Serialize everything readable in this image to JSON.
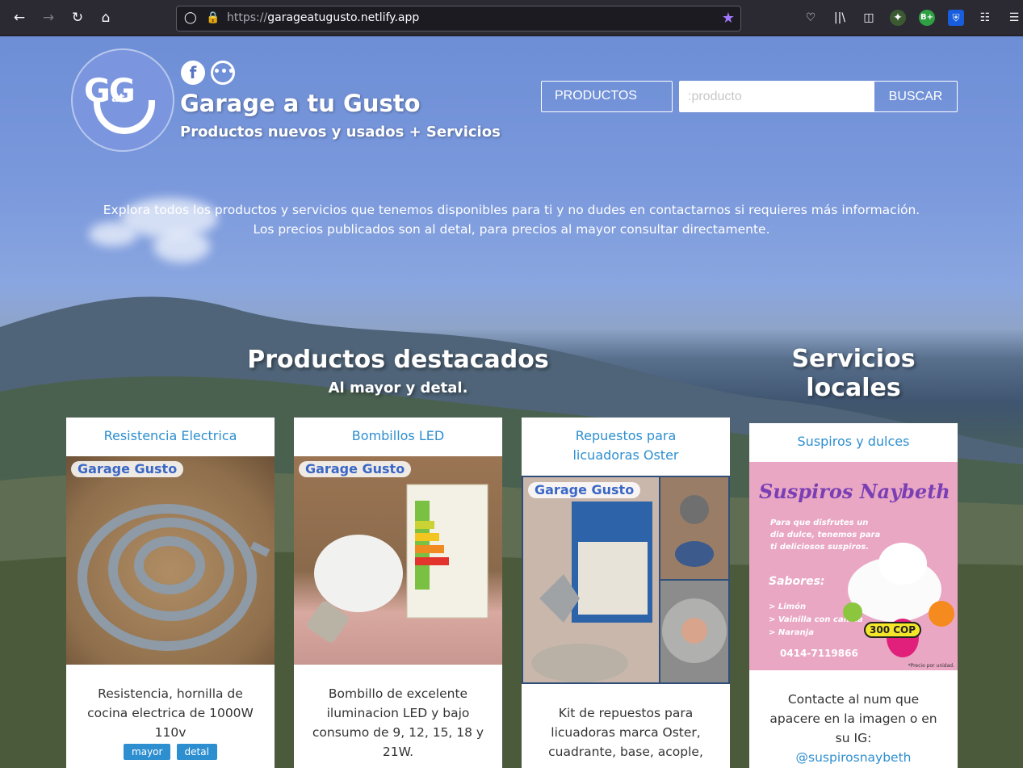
{
  "browser": {
    "url_scheme": "https://",
    "url_host": "garageatugusto.netlify.app",
    "nav_icons": [
      "back-arrow-icon",
      "forward-arrow-icon",
      "reload-icon",
      "home-icon"
    ],
    "toolbar_icons": [
      "pocket-icon",
      "library-icon",
      "sidebar-icon",
      "extension-shield-icon",
      "extension-badge-icon",
      "bitwarden-icon",
      "extension-grid-icon",
      "menu-icon"
    ],
    "ext_badge_label": "B+"
  },
  "header": {
    "logo_letters": "GG",
    "logo_at": "at",
    "title": "Garage a tu Gusto",
    "subtitle": "Productos nuevos y usados + Servicios",
    "social_icons": [
      "facebook-icon",
      "chat-icon"
    ]
  },
  "search": {
    "category_value": "PRODUCTOS",
    "placeholder": ":producto",
    "button_label": "BUSCAR"
  },
  "intro": {
    "line1": "Explora todos los productos y servicios que tenemos disponibles para ti y no dudes en contactarnos si requieres más información.",
    "line2": "Los precios publicados son al detal, para precios al mayor consultar directamente."
  },
  "featured": {
    "heading": "Productos destacados",
    "subheading": "Al mayor y detal."
  },
  "services": {
    "heading_line1": "Servicios",
    "heading_line2": "locales"
  },
  "cards": [
    {
      "title": "Resistencia Electrica",
      "image_watermark": "Garage Gusto",
      "description": "Resistencia, hornilla de cocina electrica de 1000W 110v",
      "tags": [
        "mayor",
        "detal"
      ]
    },
    {
      "title": "Bombillos LED",
      "image_watermark": "Garage Gusto",
      "description": "Bombillo de excelente iluminacion LED y bajo consumo de 9, 12, 15, 18 y 21W.",
      "tags": []
    },
    {
      "title_line1": "Repuestos para",
      "title_line2": "licuadoras Oster",
      "image_watermark": "Garage Gusto",
      "description": "Kit de repuestos para licuadoras marca Oster, cuadrante, base, acople,",
      "tags": []
    },
    {
      "title": "Suspiros y dulces",
      "flyer": {
        "brand": "Suspiros Naybeth",
        "tagline": "Para que disfrutes un dia dulce, tenemos para ti deliciosos suspiros.",
        "flavors_label": "Sabores:",
        "flavors": [
          "> Limón",
          "> Vainilla con canela",
          "> Naranja"
        ],
        "price": "300 COP",
        "phone": "0414-7119866",
        "note": "*Precio por unidad."
      },
      "description": "Contacte al num que apacere en la imagen o en su IG:",
      "instagram": "@suspirosnaybeth"
    }
  ],
  "colors": {
    "accent": "#2e8fd0",
    "sky": "#7a98dc",
    "browser_bg": "#2b2a33",
    "flyer_bg": "#e9a7c4"
  }
}
